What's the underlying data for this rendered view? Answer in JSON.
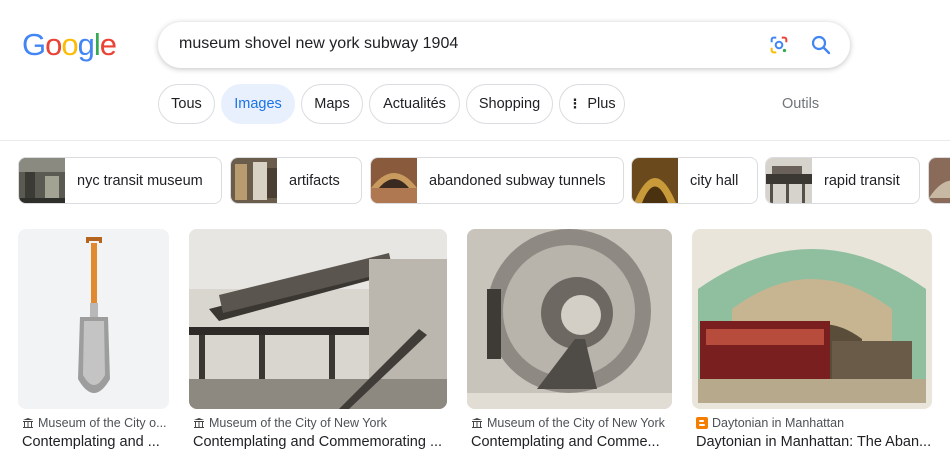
{
  "logo": "Google",
  "search": {
    "query": "museum shovel new york subway 1904"
  },
  "tabs": [
    "Tous",
    "Images",
    "Maps",
    "Actualités",
    "Shopping",
    "Plus"
  ],
  "tools_label": "Outils",
  "suggestions": [
    "nyc transit museum",
    "artifacts",
    "abandoned subway tunnels",
    "city hall",
    "rapid transit"
  ],
  "results": [
    {
      "source": "Museum of the City o...",
      "title": "Contemplating and ..."
    },
    {
      "source": "Museum of the City of New York",
      "title": "Contemplating and Commemorating ..."
    },
    {
      "source": "Museum of the City of New York",
      "title": "Contemplating and Comme..."
    },
    {
      "source": "Daytonian in Manhattan",
      "title": "Daytonian in Manhattan: The Aban..."
    }
  ],
  "colors": {
    "accent": "#1a73e8",
    "active_tab_bg": "#e8f0fe",
    "favicon_blogger": "#f57d00"
  }
}
